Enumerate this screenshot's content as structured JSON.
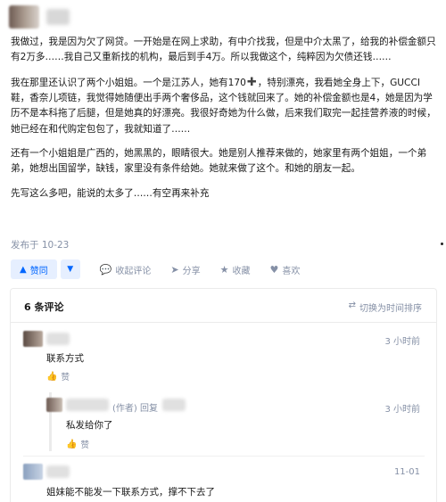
{
  "answer": {
    "paragraphs": [
      "我做过，我是因为欠了网贷。一开始是在网上求助，有中介找我，但是中介太黑了，给我的补偿金额只有2万多……我自己又重新找的机构，最后到手4万。所以我做这个，纯粹因为欠债还钱……",
      "我在那里还认识了两个小姐姐。一个是江苏人，她有170",
      "还有一个小姐姐是广西的，她黑黑的，眼睛很大。她是别人推荐来做的，她家里有两个姐姐，一个弟弟，她想出国留学，缺钱，家里没有条件给她。她就来做了这个。和她的朋友一起。",
      "先写这么多吧，能说的太多了……有空再来补充"
    ],
    "paragraph2_rest": "，特别漂亮，我看她全身上下，GUCCI鞋，香奈儿项链，我觉得她随便出手两个奢侈品，这个钱就回来了。她的补偿金额也是4，她是因为学历不是本科拖了后腿，但是她真的好漂亮。我很好奇她为什么做，后来我们取完一起挂营养液的时候，她已经在和代购定包包了，我就知道了……",
    "publish_time": "发布于 10-23"
  },
  "actions": {
    "upvote": "赞同",
    "collect": "收起评论",
    "share": "分享",
    "favorite": "收藏",
    "like": "喜欢"
  },
  "comments": {
    "count_label": "6 条评论",
    "switch_label": "切换为时间排序",
    "items": [
      {
        "time": "3 小时前",
        "text": "联系方式",
        "like": "赞"
      },
      {
        "meta": "(作者) 回复",
        "time": "3 小时前",
        "text": "私发给你了",
        "like": "赞"
      },
      {
        "time": "11-01",
        "text": "姐妹能不能发一下联系方式，撑不下去了"
      }
    ]
  }
}
